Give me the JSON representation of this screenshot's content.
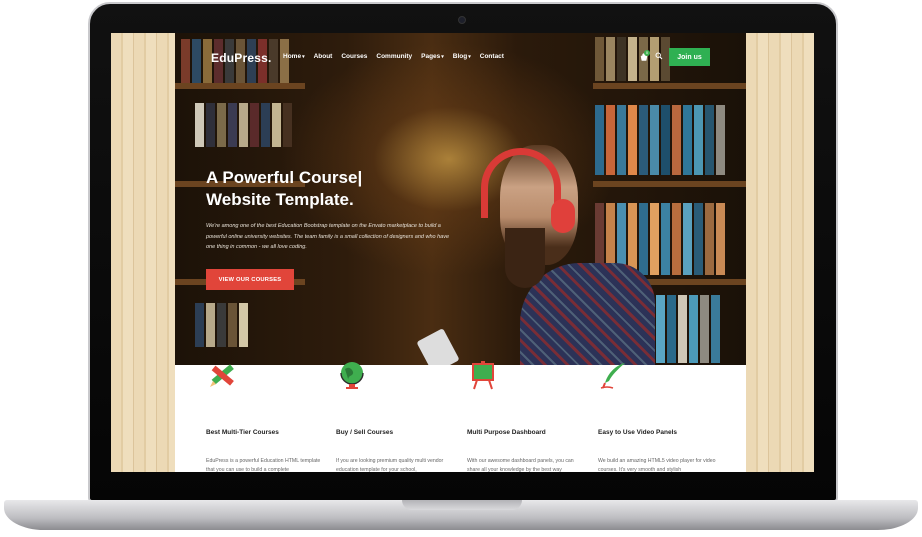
{
  "brand": {
    "logo": "EduPress."
  },
  "nav": {
    "items": [
      {
        "label": "Home",
        "caret": "▾"
      },
      {
        "label": "About",
        "caret": ""
      },
      {
        "label": "Courses",
        "caret": ""
      },
      {
        "label": "Community",
        "caret": ""
      },
      {
        "label": "Pages",
        "caret": "▾"
      },
      {
        "label": "Blog",
        "caret": "▾"
      },
      {
        "label": "Contact",
        "caret": ""
      }
    ],
    "cart_count": "0",
    "join_label": "Join us"
  },
  "hero": {
    "title_line1": "A Powerful Course|",
    "title_line2": "Website Template.",
    "description": "We're among one of the best Education Bootstrap template on the Envato marketplace to build a powerful online university websites. The team family is a small collection of designers and who have one thing in common - we all love coding.",
    "cta": "VIEW OUR COURSES"
  },
  "features": [
    {
      "title": "Best Multi-Tier Courses",
      "desc": "EduPress is a powerful Education HTML template that you can use to build a complete",
      "icon": "pencil-ruler-icon"
    },
    {
      "title": "Buy / Sell Courses",
      "desc": "If you are looking premium quality multi vendor education template for your school,",
      "icon": "globe-icon"
    },
    {
      "title": "Multi Purpose Dashboard",
      "desc": "With our awesome dashboard panels, you can share all your knowledge by the best way",
      "icon": "easel-icon"
    },
    {
      "title": "Easy to Use Video Panels",
      "desc": "We build an amazing HTML5 video player for video courses. It's very smooth and stylish",
      "icon": "quill-icon"
    }
  ],
  "colors": {
    "accent_red": "#e1453a",
    "accent_green": "#2fb052"
  }
}
